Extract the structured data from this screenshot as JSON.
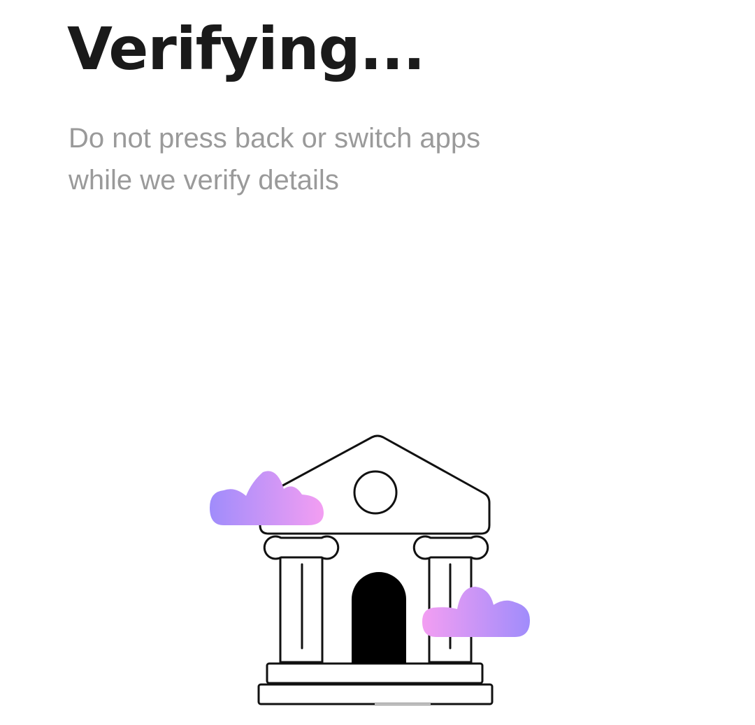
{
  "header": {
    "title": "Verifying...",
    "subtitle_lines": [
      "Do not press back or switch apps",
      "while we verify details"
    ]
  },
  "illustration": {
    "icon": "bank-building-icon",
    "decorations": [
      "cloud-icon",
      "cloud-icon"
    ]
  },
  "colors": {
    "title": "#1a1a1a",
    "subtitle": "#9a9a9a",
    "cloud_gradient_start": "#a08cfb",
    "cloud_gradient_end": "#f39ef2",
    "outline": "#111111"
  }
}
